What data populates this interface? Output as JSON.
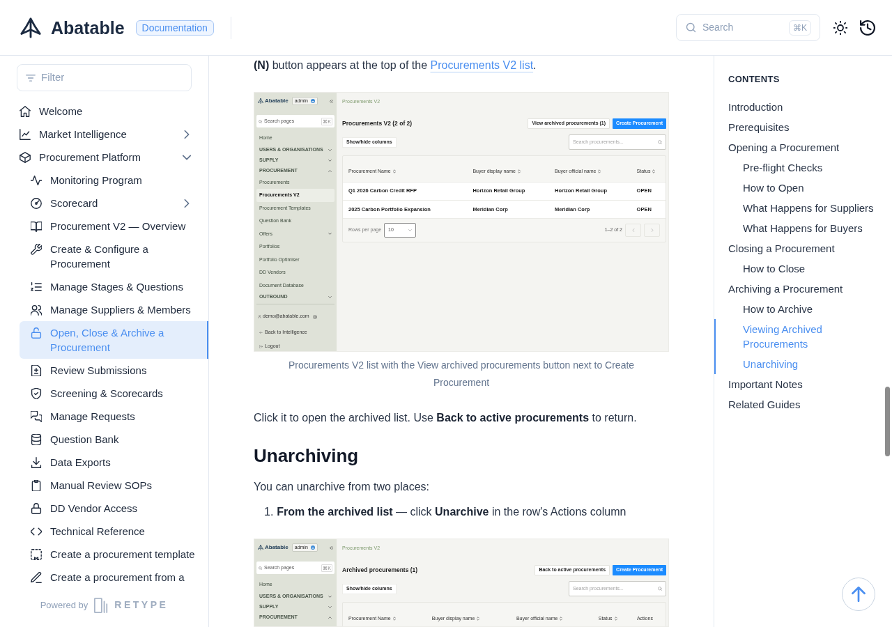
{
  "header": {
    "logo": "Abatable",
    "badge": "Documentation",
    "search": {
      "placeholder": "Search",
      "shortcut": "⌘K"
    }
  },
  "sidebar": {
    "filter": {
      "placeholder": "Filter"
    },
    "items": [
      {
        "kind": "page",
        "label": "Welcome",
        "selected": false
      },
      {
        "kind": "group",
        "label": "Market Intelligence",
        "selected": false,
        "expanded": false
      },
      {
        "kind": "group",
        "label": "Procurement Platform",
        "selected": false,
        "expanded": true,
        "children": [
          {
            "kind": "page",
            "label": "Monitoring Program",
            "selected": false
          },
          {
            "kind": "group",
            "label": "Scorecard",
            "selected": false,
            "expanded": false
          },
          {
            "kind": "page",
            "label": "Procurement V2 — Overview",
            "selected": false
          },
          {
            "kind": "page",
            "label": "Create & Configure a Procurement",
            "selected": false
          },
          {
            "kind": "page",
            "label": "Manage Stages & Questions",
            "selected": false
          },
          {
            "kind": "page",
            "label": "Manage Suppliers & Members",
            "selected": false
          },
          {
            "kind": "page",
            "label": "Open, Close & Archive a Procurement",
            "selected": true
          },
          {
            "kind": "page",
            "label": "Review Submissions",
            "selected": false
          },
          {
            "kind": "page",
            "label": "Screening & Scorecards",
            "selected": false
          },
          {
            "kind": "page",
            "label": "Manage Requests",
            "selected": false
          },
          {
            "kind": "page",
            "label": "Question Bank",
            "selected": false
          },
          {
            "kind": "page",
            "label": "Data Exports",
            "selected": false
          },
          {
            "kind": "page",
            "label": "Manual Review SOPs",
            "selected": false
          },
          {
            "kind": "page",
            "label": "DD Vendor Access",
            "selected": false
          },
          {
            "kind": "page",
            "label": "Technical Reference",
            "selected": false
          },
          {
            "kind": "page",
            "label": "Create a procurement template",
            "selected": false
          },
          {
            "kind": "page",
            "label": "Create a procurement from a",
            "selected": false
          }
        ]
      }
    ],
    "footer": {
      "prefix": "Powered by",
      "brand": "RETYPE"
    }
  },
  "article": [
    {
      "kind": "paragraph",
      "parts": [
        {
          "kind": "text",
          "text": "**(N)** button appears at the top of the "
        },
        {
          "kind": "link",
          "text": "Procurements V2 list"
        },
        {
          "kind": "text",
          "text": "."
        }
      ]
    },
    {
      "kind": "figure",
      "screenshot": {
        "sidebar": {
          "logo": "Abatable",
          "role": "admin",
          "search": {
            "placeholder": "Search pages",
            "shortcut": "⌘K"
          },
          "items": [
            {
              "kind": "link",
              "label": "Home",
              "selected": false
            },
            {
              "kind": "section",
              "label": "USERS & ORGANISATIONS",
              "expanded": false
            },
            {
              "kind": "section",
              "label": "SUPPLY",
              "expanded": false
            },
            {
              "kind": "section",
              "label": "PROCUREMENT",
              "expanded": true,
              "children": [
                {
                  "kind": "link",
                  "label": "Procurements",
                  "selected": false
                },
                {
                  "kind": "link",
                  "label": "Procurements V2",
                  "selected": true
                },
                {
                  "kind": "link",
                  "label": "Procurement Templates",
                  "selected": false
                },
                {
                  "kind": "link",
                  "label": "Question Bank",
                  "selected": false
                },
                {
                  "kind": "group",
                  "label": "Offers",
                  "expanded": false
                },
                {
                  "kind": "link",
                  "label": "Portfolios",
                  "selected": false
                },
                {
                  "kind": "link",
                  "label": "Portfolio Optimiser",
                  "selected": false
                },
                {
                  "kind": "link",
                  "label": "DD Vendors",
                  "selected": false
                },
                {
                  "kind": "link",
                  "label": "Document Database",
                  "selected": false
                }
              ]
            },
            {
              "kind": "section",
              "label": "OUTBOUND",
              "expanded": false
            }
          ],
          "user": "demo@abatable.com",
          "back": "Back to Intelligence",
          "logout": "Logout"
        },
        "breadcrumb": "Procurements V2",
        "title": "Procurements V2 (2 of 2)",
        "actions": [
          {
            "kind": "secondary",
            "label": "View archived procurements (1)"
          },
          {
            "kind": "primary",
            "label": "Create Procurement"
          }
        ],
        "columns_button": "Show/hide columns",
        "search": {
          "placeholder": "Search procurements..."
        },
        "table": {
          "columns": [
            {
              "label": "Procurement Name",
              "sortable": true
            },
            {
              "label": "Buyer display name",
              "sortable": true
            },
            {
              "label": "Buyer official name",
              "sortable": true
            },
            {
              "label": "Status",
              "sortable": true
            }
          ],
          "rows": [
            [
              "Q1 2026 Carbon Credit RFP",
              "Horizon Retail Group",
              "Horizon Retail Group",
              "OPEN"
            ],
            [
              "2025 Carbon Portfolio Expansion",
              "Meridian Corp",
              "Meridian Corp",
              "OPEN"
            ]
          ],
          "footer": {
            "rows_label": "Rows per page",
            "rows_value": "10",
            "range": "1–2 of 2"
          }
        }
      },
      "caption": "Procurements V2 list with the View archived procurements button next to Create Procurement"
    },
    {
      "kind": "paragraph",
      "parts": [
        {
          "kind": "text",
          "text": "Click it to open the archived list. Use **Back to active procurements** to return."
        }
      ]
    },
    {
      "kind": "heading",
      "text": "Unarchiving"
    },
    {
      "kind": "paragraph",
      "parts": [
        {
          "kind": "text",
          "text": "You can unarchive from two places:"
        }
      ]
    },
    {
      "kind": "ordered_list",
      "items": [
        {
          "number": "1.",
          "text": "**From the archived list** — click **Unarchive** in the row's Actions column"
        }
      ]
    },
    {
      "kind": "figure",
      "screenshot": {
        "sidebar": {
          "logo": "Abatable",
          "role": "admin",
          "search": {
            "placeholder": "Search pages",
            "shortcut": "⌘K"
          },
          "items": [
            {
              "kind": "link",
              "label": "Home",
              "selected": false
            },
            {
              "kind": "section",
              "label": "USERS & ORGANISATIONS",
              "expanded": false
            },
            {
              "kind": "section",
              "label": "SUPPLY",
              "expanded": false
            },
            {
              "kind": "section",
              "label": "PROCUREMENT",
              "expanded": true
            }
          ]
        },
        "breadcrumb": "Procurements V2",
        "title": "Archived procurements (1)",
        "actions": [
          {
            "kind": "secondary",
            "label": "Back to active procurements"
          },
          {
            "kind": "primary",
            "label": "Create Procurement"
          }
        ],
        "columns_button": "Show/hide columns",
        "search": {
          "placeholder": "Search procurements..."
        },
        "table": {
          "columns": [
            {
              "label": "Procurement Name",
              "sortable": true
            },
            {
              "label": "Buyer display name",
              "sortable": true
            },
            {
              "label": "Buyer official name",
              "sortable": true
            },
            {
              "label": "Status",
              "sortable": true
            },
            {
              "label": "Actions",
              "sortable": false
            }
          ]
        }
      }
    }
  ],
  "toc": {
    "title": "CONTENTS",
    "items": [
      {
        "label": "Introduction",
        "selected": false
      },
      {
        "label": "Prerequisites",
        "selected": false
      },
      {
        "label": "Opening a Procurement",
        "selected": false,
        "children": [
          {
            "label": "Pre-flight Checks",
            "selected": false
          },
          {
            "label": "How to Open",
            "selected": false
          },
          {
            "label": "What Happens for Suppliers",
            "selected": false
          },
          {
            "label": "What Happens for Buyers",
            "selected": false
          }
        ]
      },
      {
        "label": "Closing a Procurement",
        "selected": false,
        "children": [
          {
            "label": "How to Close",
            "selected": false
          }
        ]
      },
      {
        "label": "Archiving a Procurement",
        "selected": false,
        "children": [
          {
            "label": "How to Archive",
            "selected": false
          },
          {
            "label": "Viewing Archived Procurements",
            "selected": true
          },
          {
            "label": "Unarchiving",
            "selected": true
          }
        ]
      },
      {
        "label": "Important Notes",
        "selected": false
      },
      {
        "label": "Related Guides",
        "selected": false
      }
    ]
  }
}
